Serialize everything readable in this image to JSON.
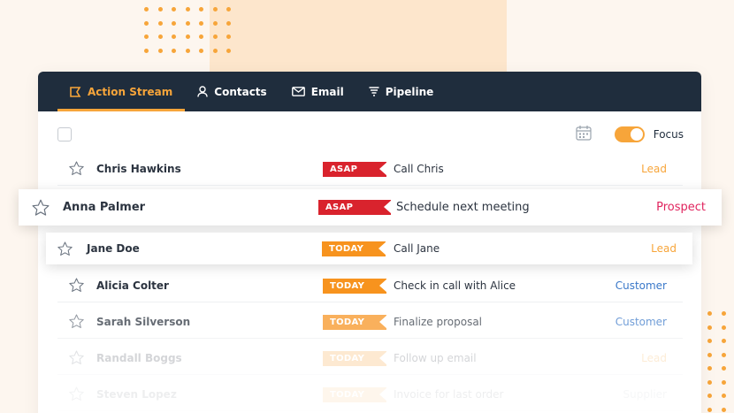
{
  "nav": {
    "tabs": [
      {
        "label": "Action Stream",
        "icon": "action-stream-icon",
        "active": true
      },
      {
        "label": "Contacts",
        "icon": "person-icon",
        "active": false
      },
      {
        "label": "Email",
        "icon": "envelope-icon",
        "active": false
      },
      {
        "label": "Pipeline",
        "icon": "funnel-icon",
        "active": false
      }
    ]
  },
  "toolbar": {
    "focus_label": "Focus",
    "focus_on": true,
    "calendar_icon": "calendar-icon"
  },
  "rows": [
    {
      "name": "Chris Hawkins",
      "tag": "ASAP",
      "task": "Call Chris",
      "status": "Lead"
    },
    {
      "name": "Anna Palmer",
      "tag": "ASAP",
      "task": "Schedule next meeting",
      "status": "Prospect"
    },
    {
      "name": "Jane Doe",
      "tag": "TODAY",
      "task": "Call Jane",
      "status": "Lead"
    },
    {
      "name": "Alicia Colter",
      "tag": "TODAY",
      "task": "Check in call with Alice",
      "status": "Customer"
    },
    {
      "name": "Sarah Silverson",
      "tag": "TODAY",
      "task": "Finalize proposal",
      "status": "Customer"
    },
    {
      "name": "Randall Boggs",
      "tag": "TODAY",
      "task": "Follow up email",
      "status": "Lead"
    },
    {
      "name": "Steven Lopez",
      "tag": "TODAY",
      "task": "Invoice for last order",
      "status": "Supplier"
    }
  ],
  "colors": {
    "accent": "#f7a53a",
    "navbar": "#1f2d3d",
    "asap": "#d9232d",
    "today": "#f7931e",
    "lead": "#f7a53a",
    "prospect": "#e0245e",
    "customer": "#3a78c9",
    "supplier": "#9aa3ad"
  }
}
